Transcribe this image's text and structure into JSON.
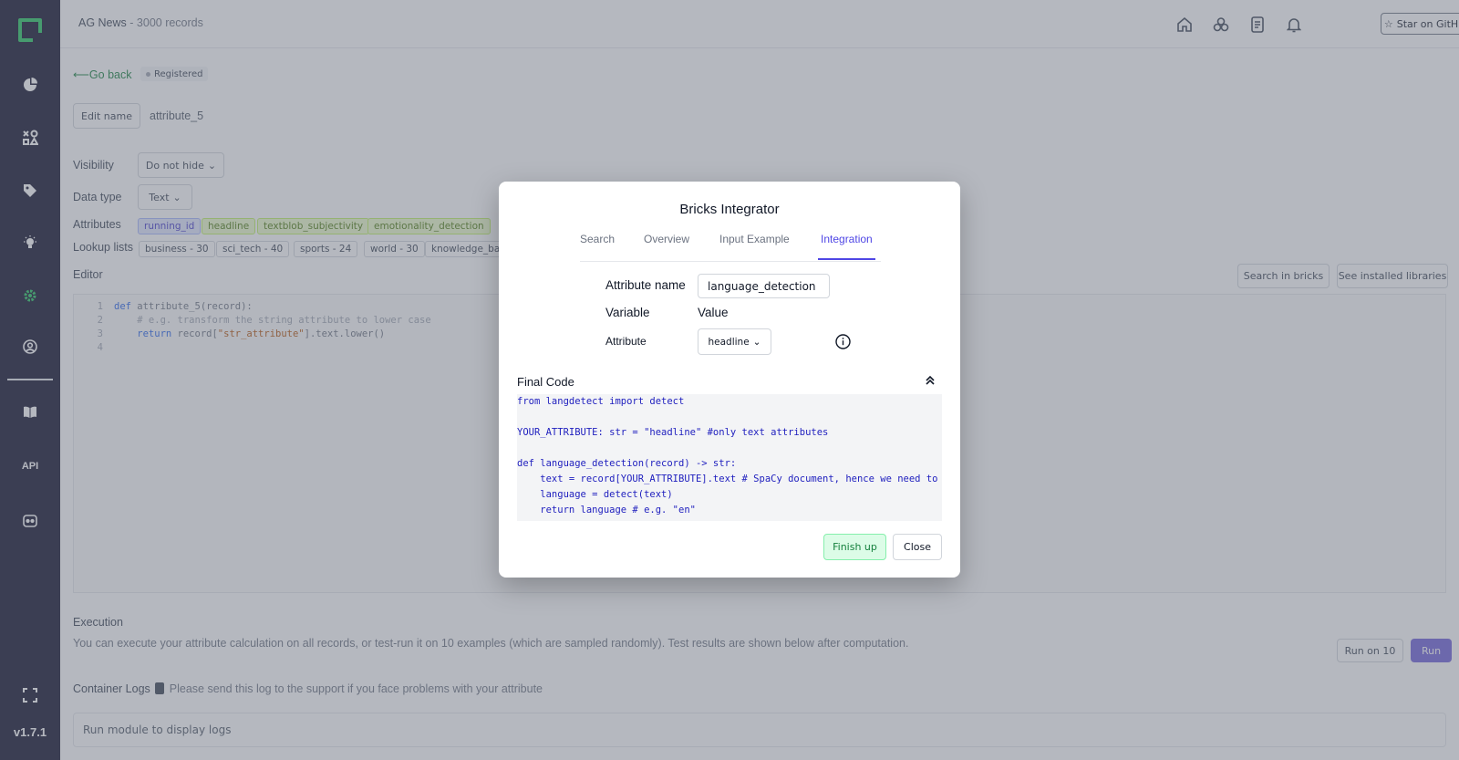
{
  "app": {
    "title": "AG News",
    "subtitle": "- 3000 records",
    "github_label": "Star on GitHub",
    "version": "v1.7.1"
  },
  "sidebar": {
    "items": [
      "overview",
      "data-browser",
      "labeling",
      "heuristics",
      "settings",
      "admin",
      "docs",
      "api",
      "community"
    ],
    "bottom": [
      "fullscreen"
    ]
  },
  "page": {
    "go_back": "Go back",
    "status": "Registered",
    "edit_name": "Edit name",
    "attribute_name": "attribute_5",
    "visibility_label": "Visibility",
    "visibility_value": "Do not hide",
    "datatype_label": "Data type",
    "datatype_value": "Text",
    "attributes_label": "Attributes",
    "attributes": [
      "running_id",
      "headline",
      "textblob_subjectivity",
      "emotionality_detection"
    ],
    "lookup_label": "Lookup lists",
    "lookup_lists": [
      "business - 30",
      "sci_tech - 40",
      "sports - 24",
      "world - 30",
      "knowledge_base"
    ],
    "editor_label": "Editor",
    "search_bricks": "Search in bricks",
    "installed_libs": "See installed libraries",
    "editor_lines": [
      {
        "num": "1"
      },
      {
        "num": "2"
      },
      {
        "num": "3"
      },
      {
        "num": "4"
      }
    ],
    "editor_code": {
      "l1_kw": "def",
      "l1_rest": " attribute_5(record):",
      "l2": "    # e.g. transform the string attribute to lower case",
      "l3_kw": "    return",
      "l3_a": " record[",
      "l3_str": "\"str_attribute\"",
      "l3_b": "].text.lower()"
    },
    "execution_label": "Execution",
    "execution_text": "You can execute your attribute calculation on all records, or test-run it on 10 examples (which are sampled randomly). Test results are shown below after computation.",
    "run_on_10": "Run on 10",
    "run": "Run",
    "logs_label": "Container Logs",
    "logs_hint": "Please send this log to the support if you face problems with your attribute",
    "logs_placeholder": "Run module to display logs"
  },
  "modal": {
    "title": "Bricks Integrator",
    "tabs": [
      "Search",
      "Overview",
      "Input Example",
      "Integration"
    ],
    "active_tab": "Integration",
    "attr_name_label": "Attribute name",
    "attr_name_value": "language_detection",
    "variable_label": "Variable",
    "value_label": "Value",
    "attribute_label": "Attribute",
    "attribute_value": "headline",
    "final_code_label": "Final Code",
    "code_lines": [
      "from langdetect import detect",
      "",
      "YOUR_ATTRIBUTE: str = \"headline\" #only text attributes",
      "",
      "def language_detection(record) -> str:",
      "    text = record[YOUR_ATTRIBUTE].text # SpaCy document, hence we need to call .text to get the string",
      "    language = detect(text)",
      "    return language # e.g. \"en\""
    ],
    "finish": "Finish up",
    "close": "Close"
  },
  "colors": {
    "sidebar": "#0b0a26",
    "accent_green": "#22c55e",
    "accent_indigo": "#4f46e5",
    "run_button": "#6d5ed8"
  }
}
